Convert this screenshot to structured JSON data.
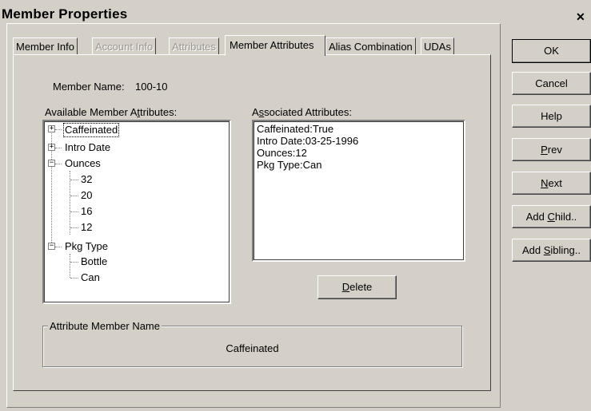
{
  "window": {
    "title": "Member Properties",
    "close_glyph": "✕"
  },
  "tabs": [
    {
      "label": "Member Info",
      "state": "enabled"
    },
    {
      "label": "Account Info",
      "state": "disabled"
    },
    {
      "label": "Attributes",
      "state": "disabled"
    },
    {
      "label": "Member Attributes",
      "state": "active"
    },
    {
      "label": "Alias Combination",
      "state": "enabled"
    },
    {
      "label": "UDAs",
      "state": "enabled"
    }
  ],
  "member": {
    "name_label": "Member Name:",
    "name_value": "100-10"
  },
  "available": {
    "label_pre": "Available Member A",
    "label_mn": "t",
    "label_post": "tributes:",
    "tree": [
      {
        "label": "Caffeinated",
        "expander": "+",
        "selected": true
      },
      {
        "label": "Intro Date",
        "expander": "+"
      },
      {
        "label": "Ounces",
        "expander": "−",
        "children": [
          "32",
          "20",
          "16",
          "12"
        ]
      },
      {
        "label": "Pkg Type",
        "expander": "−",
        "children": [
          "Bottle",
          "Can"
        ]
      }
    ]
  },
  "associated": {
    "label_pre": "A",
    "label_mn": "s",
    "label_post": "sociated Attributes:",
    "items": [
      "Caffeinated:True",
      "Intro Date:03-25-1996",
      "Ounces:12",
      "Pkg Type:Can"
    ]
  },
  "delete_button": {
    "mn": "D",
    "rest": "elete"
  },
  "attribute_member": {
    "legend": "Attribute Member Name",
    "value": "Caffeinated"
  },
  "side_buttons": {
    "ok": "OK",
    "cancel": "Cancel",
    "help": "Help",
    "prev": {
      "mn": "P",
      "rest": "rev"
    },
    "next": {
      "mn": "N",
      "rest": "ext"
    },
    "add_child": {
      "pre": "Add ",
      "mn": "C",
      "rest": "hild.."
    },
    "add_sibling": {
      "pre": "Add ",
      "mn": "S",
      "rest": "ibling.."
    }
  }
}
